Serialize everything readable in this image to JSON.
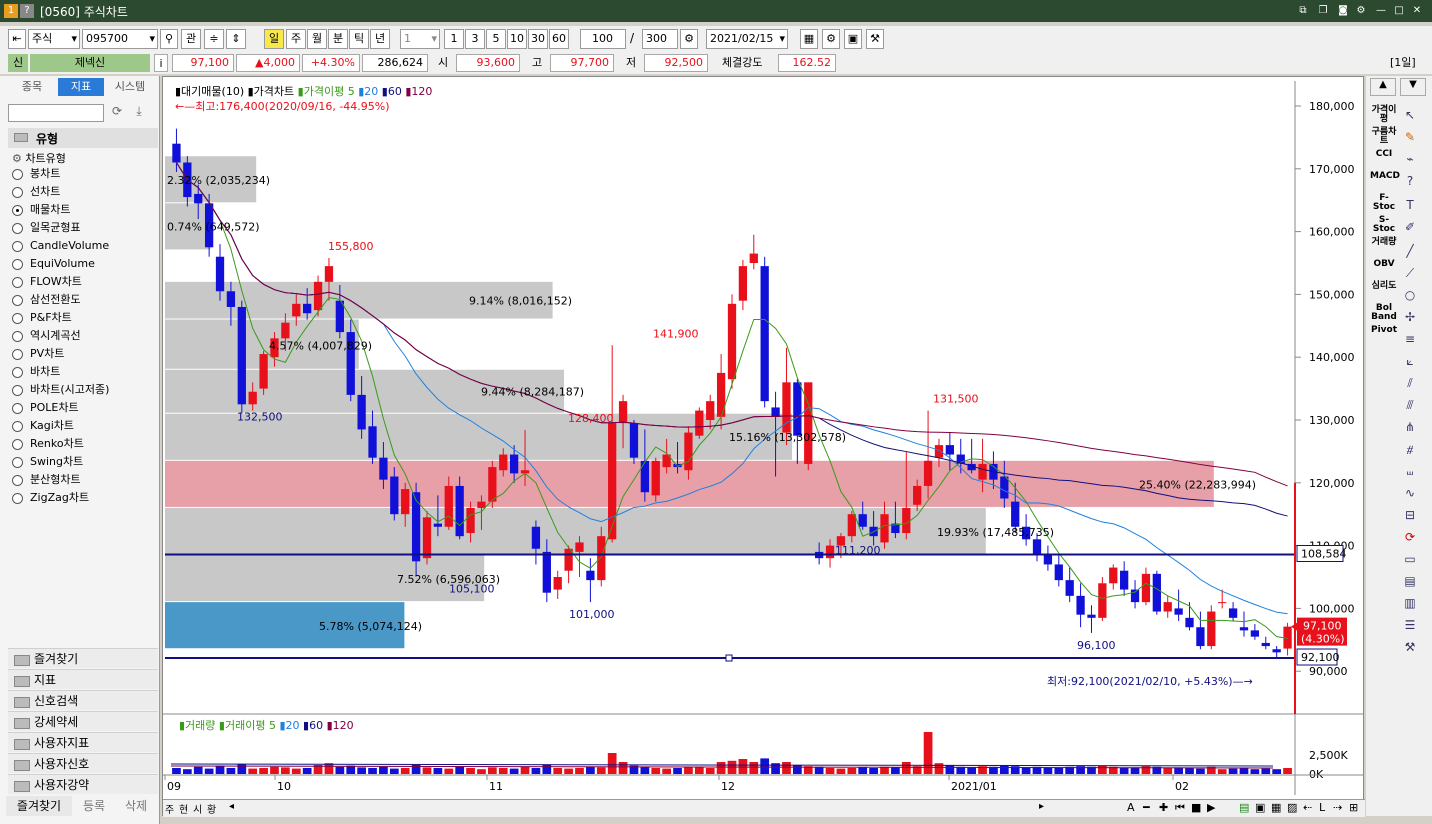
{
  "window": {
    "title": "[0560] 주식차트"
  },
  "toolbar": {
    "market": "주식",
    "code": "095700",
    "btn_gwan": "관",
    "periods": [
      "일",
      "주",
      "월",
      "분",
      "틱",
      "년"
    ],
    "unit_select": "1",
    "quick": [
      "1",
      "3",
      "5",
      "10",
      "30",
      "60"
    ],
    "count": "100",
    "slash": "/",
    "total": "300",
    "date": "2021/02/15"
  },
  "info": {
    "tag": "신",
    "name": "제넥신",
    "i": "i",
    "price": "97,100",
    "change": "▲4,000",
    "pct": "+4.30%",
    "volume": "286,624",
    "open_label": "시",
    "open": "93,600",
    "high_label": "고",
    "high": "97,700",
    "low_label": "저",
    "low": "92,500",
    "strength_label": "체결강도",
    "strength": "162.52",
    "period_badge": "[1일]"
  },
  "left": {
    "tabs": [
      "종목",
      "지표",
      "시스템"
    ],
    "section": "유형",
    "subsection": "차트유형",
    "types": [
      "봉차트",
      "선차트",
      "매물차트",
      "일목균형표",
      "CandleVolume",
      "EquiVolume",
      "FLOW차트",
      "삼선전환도",
      "P&F차트",
      "역시계곡선",
      "PV차트",
      "바차트",
      "바차트(시고저종)",
      "POLE차트",
      "Kagi차트",
      "Renko차트",
      "Swing차트",
      "분산형차트",
      "ZigZag차트"
    ],
    "selected": "매물차트",
    "folders": [
      "즐겨찾기",
      "지표",
      "신호검색",
      "강세약세",
      "사용자지표",
      "사용자신호",
      "사용자강약"
    ],
    "bottom": [
      "즐겨찾기",
      "등록",
      "삭제"
    ]
  },
  "chart": {
    "legend": {
      "a": "▮대기매물(10)",
      "b": "▮가격차트",
      "c": "▮가격이평 5",
      "d": "▮20",
      "e": "▮60",
      "f": "▮120"
    },
    "max_label": "←—최고:176,400(2020/09/16, -44.95%)",
    "min_label": "최저:92,100(2021/02/10, +5.43%)—→",
    "peaks": [
      "155,800",
      "141,900",
      "131,500",
      "128,400"
    ],
    "troughs": [
      "132,500",
      "105,100",
      "101,000",
      "111,200",
      "96,100"
    ],
    "profile_labels": [
      "2.32% (2,035,234)",
      "0.74% (649,572)",
      "9.14% (8,016,152)",
      "4.57% (4,007,829)",
      "9.44% (8,284,187)",
      "15.16% (13,302,578)",
      "25.40% (22,283,994)",
      "19.93% (17,485,735)",
      "7.52% (6,596,063)",
      "5.78% (5,074,124)"
    ],
    "hline_price": "108,584",
    "low_line_price": "92,100",
    "last_price": "97,100",
    "last_pct": "(4.30%)",
    "yticks": [
      "180,000",
      "170,000",
      "160,000",
      "150,000",
      "140,000",
      "130,000",
      "120,000",
      "110,000",
      "100,000",
      "90,000"
    ],
    "vol_legend": {
      "a": "▮거래량",
      "b": "▮거래이평 5",
      "c": "▮20",
      "d": "▮60",
      "e": "▮120"
    },
    "vol_ticks": [
      "2,500K",
      "0K"
    ],
    "xticks": [
      "09",
      "10",
      "11",
      "12",
      "2021/01",
      "02"
    ],
    "bottom_btns": [
      "주",
      "현",
      "시",
      "황"
    ],
    "colors": {
      "up": "#e8101a",
      "down": "#1010d8",
      "ma5": "#3a9a1a",
      "ma20": "#2080e0",
      "ma60": "#101080",
      "ma120": "#800040"
    }
  },
  "rtool": [
    "가격이평",
    "구름차트",
    "CCI",
    "MACD",
    "F-Stoc",
    "S-Stoc",
    "거래량",
    "OBV",
    "심리도",
    "Bol Band",
    "Pivot"
  ]
}
